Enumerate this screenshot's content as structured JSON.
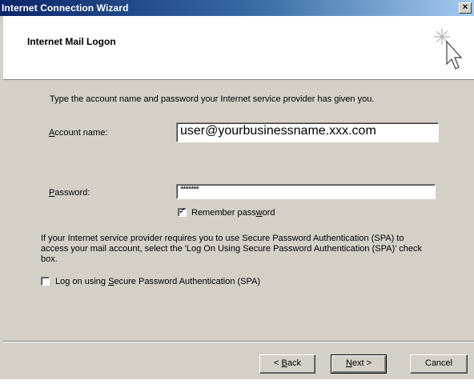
{
  "window": {
    "title": "Internet Connection Wizard",
    "close_glyph": "×"
  },
  "header": {
    "title": "Internet Mail Logon",
    "icon": "wizard-wand-cursor-icon"
  },
  "intro_text": "Type the account name and password your Internet service provider has given you.",
  "account": {
    "label_accel": "A",
    "label_rest": "ccount name:",
    "value": "user@yourbusinessname.xxx.com"
  },
  "password": {
    "label_accel": "P",
    "label_rest": "assword:",
    "value": "*******"
  },
  "remember": {
    "label_pre": "Remember pass",
    "label_accel": "w",
    "label_post": "ord",
    "checked": true,
    "mark": "✓"
  },
  "spa_paragraph": "If your Internet service provider requires you to use Secure Password Authentication (SPA) to access your mail account, select the 'Log On Using Secure Password Authentication (SPA)' check box.",
  "spa": {
    "label_pre": "Log on using ",
    "label_accel": "S",
    "label_post": "ecure Password Authentication (SPA)",
    "checked": false
  },
  "buttons": {
    "back_prefix": "< ",
    "back_accel": "B",
    "back_rest": "ack",
    "next_accel": "N",
    "next_rest": "ext >",
    "cancel": "Cancel"
  }
}
